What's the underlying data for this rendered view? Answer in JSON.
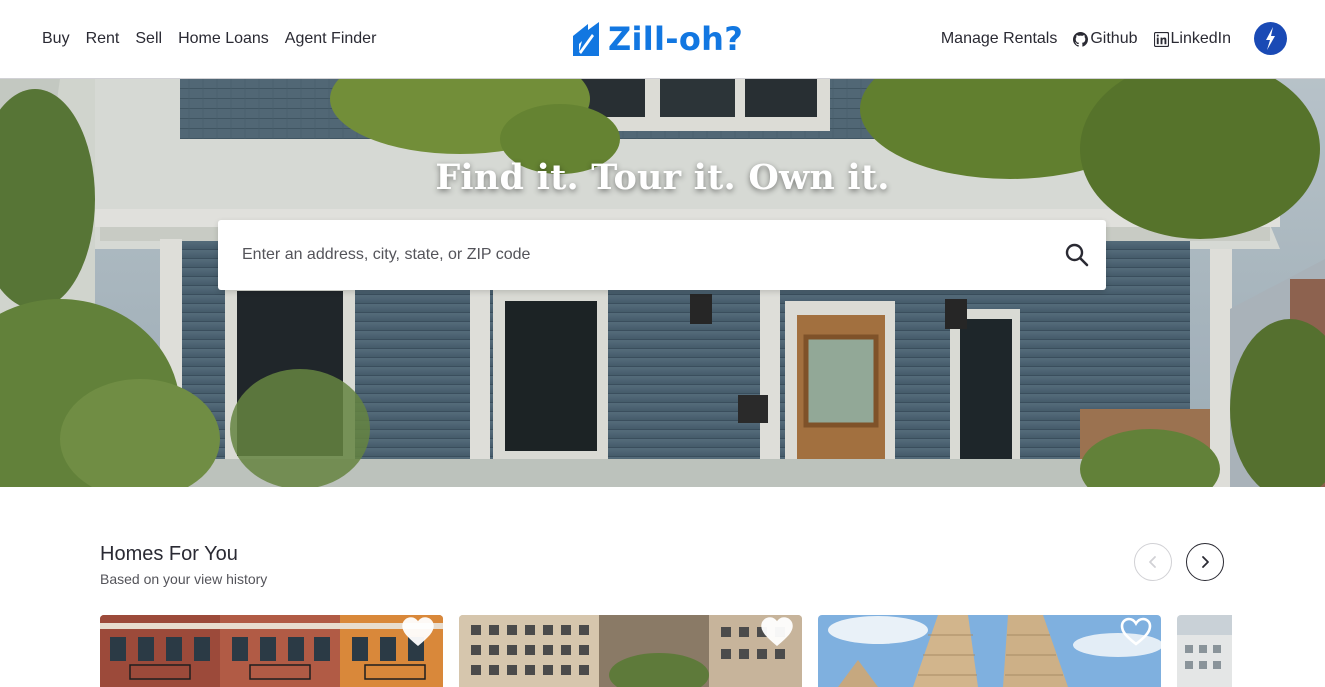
{
  "header": {
    "nav_left": [
      "Buy",
      "Rent",
      "Sell",
      "Home Loans",
      "Agent Finder"
    ],
    "logo_text": "Zill-oh?",
    "nav_right": {
      "manage_rentals": "Manage Rentals",
      "github": "Github",
      "linkedin": "LinkedIn"
    },
    "brand_color": "#1277e1",
    "avatar_color": "#1a4ab5"
  },
  "hero": {
    "title": "Find it. Tour it. Own it.",
    "search_placeholder": "Enter an address, city, state, or ZIP code",
    "search_icon": "search-icon"
  },
  "homes_section": {
    "title": "Homes For You",
    "subtitle": "Based on your view history",
    "prev_icon": "chevron-left-icon",
    "next_icon": "chevron-right-icon",
    "cards": [
      {
        "photo": "brick-rowhouses",
        "favorite_icon": "heart-icon"
      },
      {
        "photo": "apartment-tower",
        "favorite_icon": "heart-icon"
      },
      {
        "photo": "twin-skyscrapers",
        "favorite_icon": "heart-icon"
      },
      {
        "photo": "city-buildings"
      }
    ]
  }
}
